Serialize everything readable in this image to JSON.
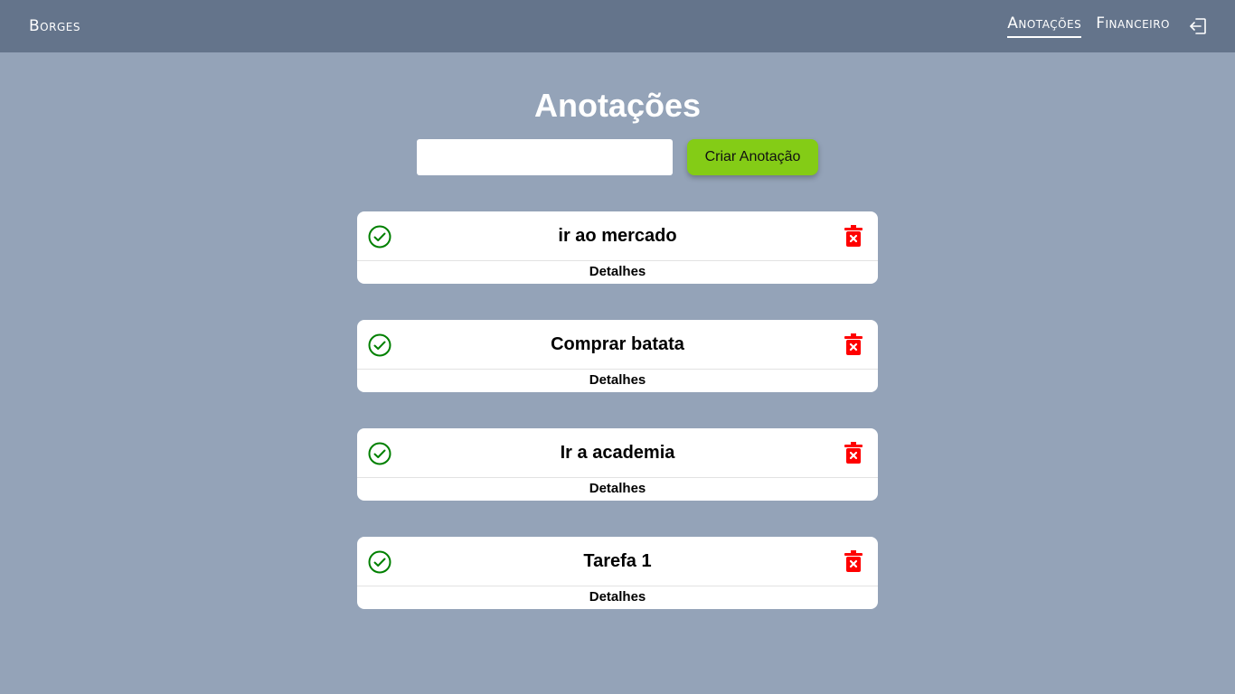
{
  "navbar": {
    "brand": "Borges",
    "links": [
      {
        "label": "Anotações",
        "active": true
      },
      {
        "label": "Financeiro",
        "active": false
      }
    ],
    "logout_icon": "logout-icon"
  },
  "page": {
    "title": "Anotações",
    "create_input": {
      "value": "",
      "placeholder": ""
    },
    "create_button_label": "Criar Anotação"
  },
  "notes": [
    {
      "title": "ir ao mercado",
      "details_label": "Detalhes"
    },
    {
      "title": "Comprar batata",
      "details_label": "Detalhes"
    },
    {
      "title": "Ir a academia",
      "details_label": "Detalhes"
    },
    {
      "title": "Tarefa 1",
      "details_label": "Detalhes"
    }
  ],
  "colors": {
    "navbar_bg": "#64748b",
    "page_bg": "#94a3b8",
    "accent_button": "#84cc16",
    "check_color": "#008000",
    "trash_color": "#ff0000"
  }
}
